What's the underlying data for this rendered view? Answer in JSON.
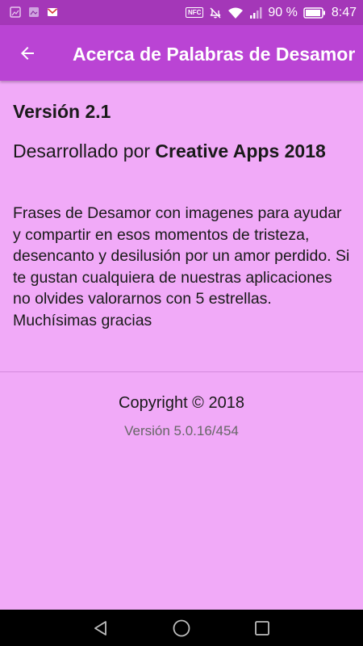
{
  "status_bar": {
    "nfc_label": "NFC",
    "battery": "90 %",
    "time": "8:47",
    "icons": [
      "gallery-notification-icon",
      "photo-notification-icon",
      "gmail-notification-icon",
      "nfc-icon",
      "vibrate-off-icon",
      "wifi-icon",
      "signal-icon",
      "battery-icon"
    ]
  },
  "app_bar": {
    "title": "Acerca de Palabras de Desamor",
    "back_icon": "arrow-left-icon",
    "background": "#ba44d4"
  },
  "about": {
    "version_title": "Versión 2.1",
    "developed_by_prefix": "Desarrollado por ",
    "developer_name": "Creative Apps 2018",
    "description": "Frases de Desamor con imagenes para ayudar y compartir en esos momentos de tristeza, desencanto y desilusión por un amor perdido. Si te gustan cualquiera de nuestras aplicaciones no olvides valorarnos con 5 estrellas. Muchísimas gracias",
    "copyright": "Copyright © 2018",
    "app_version": "Versión 5.0.16/454"
  },
  "nav_bar": {
    "buttons": [
      "back-triangle-icon",
      "home-circle-icon",
      "recents-square-icon"
    ]
  },
  "colors": {
    "status_bar": "#a437b8",
    "app_bar": "#ba44d4",
    "content_background": "#f1aaf8",
    "secondary_text": "#666666"
  }
}
